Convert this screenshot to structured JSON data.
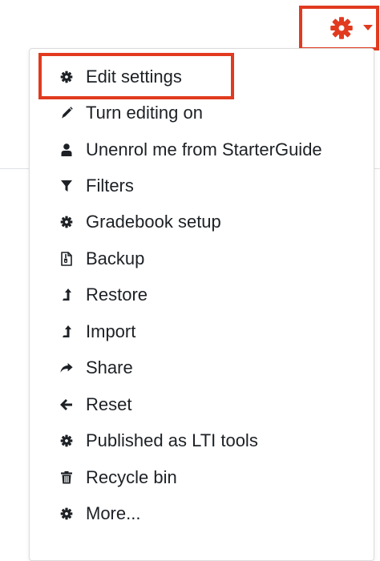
{
  "header": {
    "settings_icon": "gear-icon",
    "caret_icon": "caret-down-icon",
    "accent_color": "#e13a1f"
  },
  "menu": {
    "items": [
      {
        "label": "Edit settings",
        "icon": "gear-icon"
      },
      {
        "label": "Turn editing on",
        "icon": "pencil-icon"
      },
      {
        "label": "Unenrol me from StarterGuide",
        "icon": "user-icon"
      },
      {
        "label": "Filters",
        "icon": "filter-icon"
      },
      {
        "label": "Gradebook setup",
        "icon": "gear-icon"
      },
      {
        "label": "Backup",
        "icon": "backup-file-icon"
      },
      {
        "label": "Restore",
        "icon": "level-up-icon"
      },
      {
        "label": "Import",
        "icon": "level-up-icon"
      },
      {
        "label": "Share",
        "icon": "share-arrow-icon"
      },
      {
        "label": "Reset",
        "icon": "arrow-left-icon"
      },
      {
        "label": "Published as LTI tools",
        "icon": "gear-icon"
      },
      {
        "label": "Recycle bin",
        "icon": "trash-icon"
      },
      {
        "label": "More...",
        "icon": "gear-icon"
      }
    ]
  }
}
